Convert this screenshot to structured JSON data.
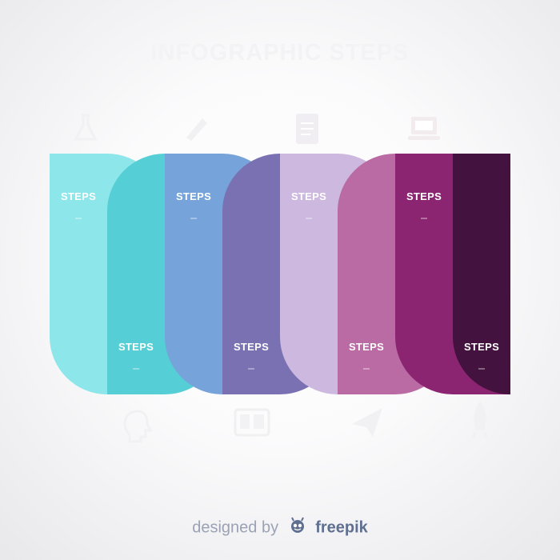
{
  "title": "INFOGRAPHIC STEPS",
  "colors": {
    "s1": "#8de6e9",
    "s2": "#55ced6",
    "s3": "#75a3da",
    "s4": "#7a71b2",
    "s5": "#cdb9df",
    "s6": "#ba6ba4",
    "s7": "#8c2571",
    "s8": "#44123f"
  },
  "steps": [
    {
      "label": "STEPS",
      "color": "#8de6e9",
      "dir": "top"
    },
    {
      "label": "STEPS",
      "color": "#55ced6",
      "dir": "bottom"
    },
    {
      "label": "STEPS",
      "color": "#75a3da",
      "dir": "top"
    },
    {
      "label": "STEPS",
      "color": "#7a71b2",
      "dir": "bottom"
    },
    {
      "label": "STEPS",
      "color": "#cdb9df",
      "dir": "top"
    },
    {
      "label": "STEPS",
      "color": "#ba6ba4",
      "dir": "bottom"
    },
    {
      "label": "STEPS",
      "color": "#8c2571",
      "dir": "top"
    },
    {
      "label": "STEPS",
      "color": "#44123f",
      "dir": "bottom"
    }
  ],
  "icons": [
    "flask-icon",
    "pencil-icon",
    "document-icon",
    "laptop-icon",
    "head-gear-icon",
    "picture-icon",
    "paper-plane-icon",
    "rocket-icon"
  ],
  "footer": {
    "prefix": "designed by",
    "brand": "freepik"
  }
}
